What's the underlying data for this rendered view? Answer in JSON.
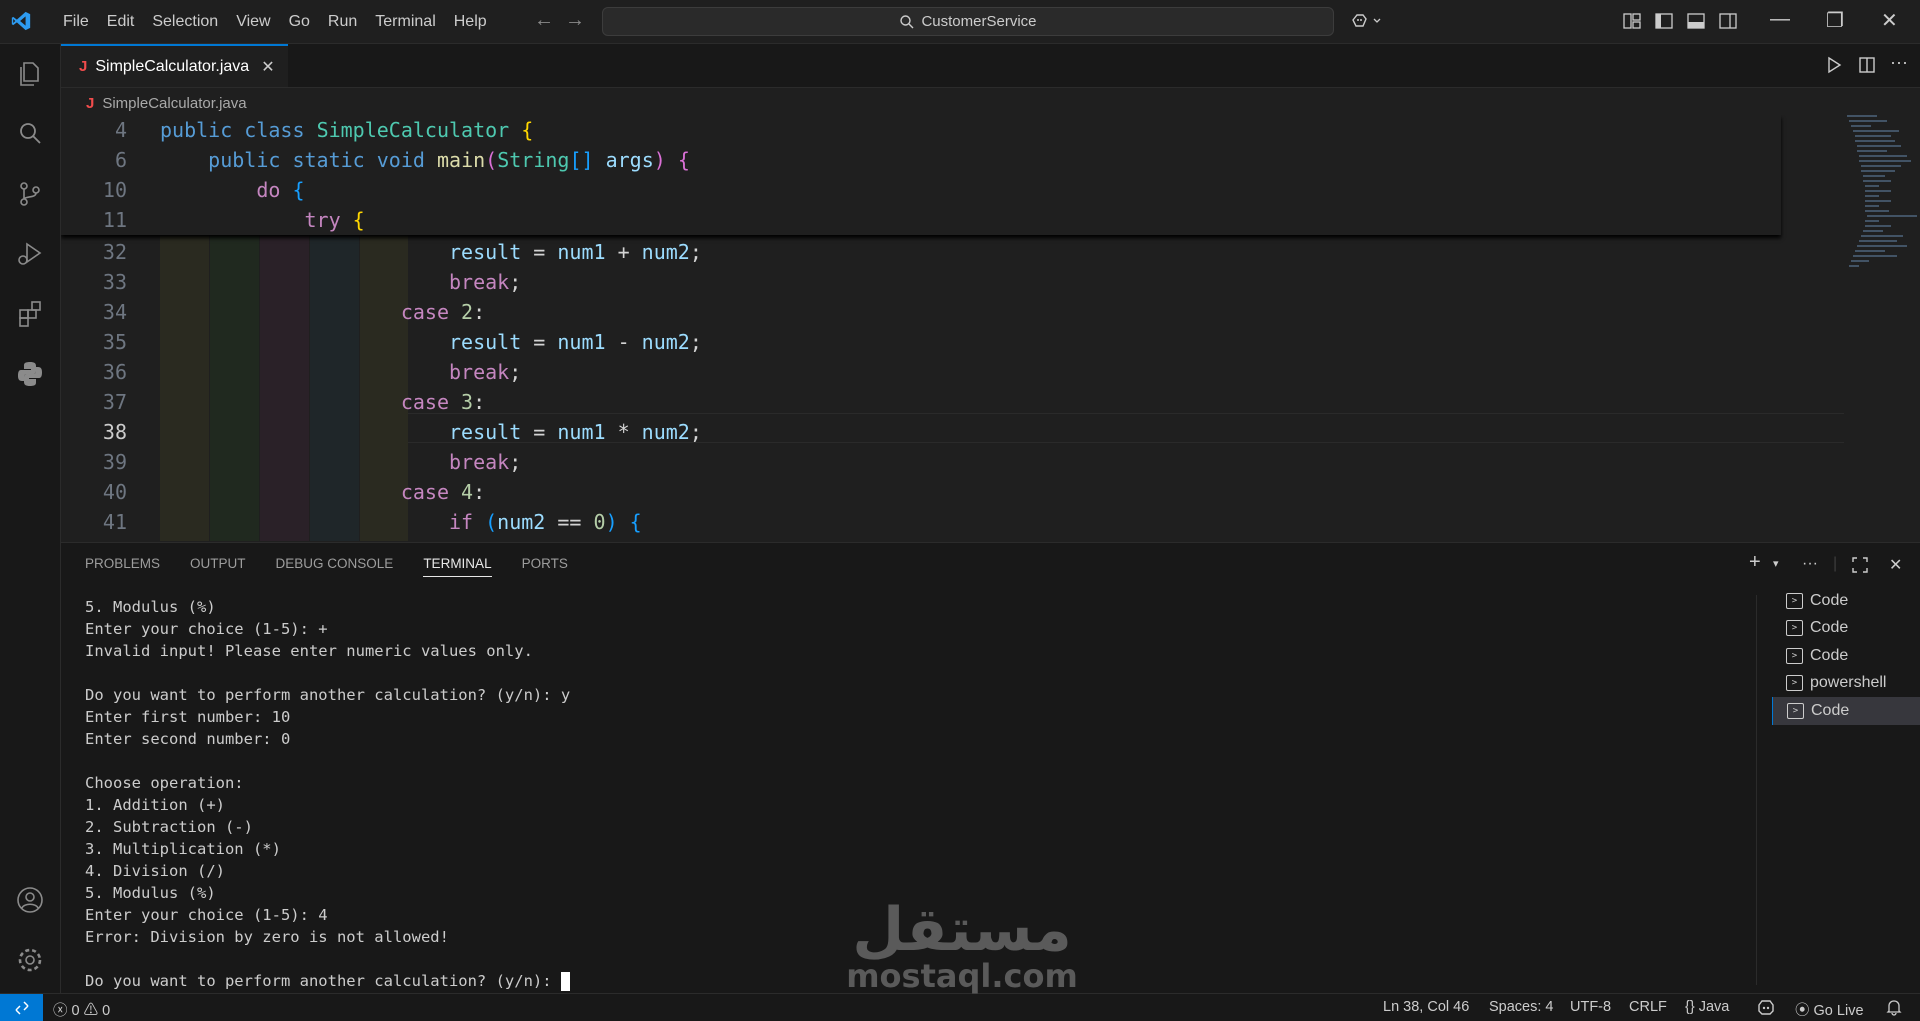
{
  "menu": [
    "File",
    "Edit",
    "Selection",
    "View",
    "Go",
    "Run",
    "Terminal",
    "Help"
  ],
  "search": {
    "label": "CustomerService"
  },
  "tab": {
    "icon_letter": "J",
    "name": "SimpleCalculator.java",
    "close": "✕"
  },
  "breadcrumb": {
    "file": "SimpleCalculator.java"
  },
  "editor": {
    "sticky_lines": [
      {
        "ln": "4",
        "segments": [
          [
            "kw",
            "public"
          ],
          [
            "op",
            " "
          ],
          [
            "kw",
            "class"
          ],
          [
            "op",
            " "
          ],
          [
            "cls",
            "SimpleCalculator"
          ],
          [
            "op",
            " "
          ],
          [
            "br1",
            "{"
          ]
        ]
      },
      {
        "ln": "6",
        "segments": [
          [
            "op",
            "    "
          ],
          [
            "kw",
            "public"
          ],
          [
            "op",
            " "
          ],
          [
            "kw",
            "static"
          ],
          [
            "op",
            " "
          ],
          [
            "kw",
            "void"
          ],
          [
            "op",
            " "
          ],
          [
            "fn",
            "main"
          ],
          [
            "br2",
            "("
          ],
          [
            "cls",
            "String"
          ],
          [
            "br3",
            "[]"
          ],
          [
            "op",
            " "
          ],
          [
            "var",
            "args"
          ],
          [
            "br2",
            ")"
          ],
          [
            "op",
            " "
          ],
          [
            "br2",
            "{"
          ]
        ]
      },
      {
        "ln": "10",
        "segments": [
          [
            "op",
            "        "
          ],
          [
            "kw2",
            "do"
          ],
          [
            "op",
            " "
          ],
          [
            "br3",
            "{"
          ]
        ]
      },
      {
        "ln": "11",
        "segments": [
          [
            "op",
            "            "
          ],
          [
            "kw2",
            "try"
          ],
          [
            "op",
            " "
          ],
          [
            "br1",
            "{"
          ]
        ]
      }
    ],
    "lines": [
      {
        "ln": "32",
        "segments": [
          [
            "op",
            "                        "
          ],
          [
            "var",
            "result"
          ],
          [
            "op",
            " = "
          ],
          [
            "var",
            "num1"
          ],
          [
            "op",
            " + "
          ],
          [
            "var",
            "num2"
          ],
          [
            "op",
            ";"
          ]
        ]
      },
      {
        "ln": "33",
        "segments": [
          [
            "op",
            "                        "
          ],
          [
            "kw2",
            "break"
          ],
          [
            "op",
            ";"
          ]
        ]
      },
      {
        "ln": "34",
        "segments": [
          [
            "op",
            "                    "
          ],
          [
            "kw2",
            "case"
          ],
          [
            "op",
            " "
          ],
          [
            "num",
            "2"
          ],
          [
            "op",
            ":"
          ]
        ]
      },
      {
        "ln": "35",
        "segments": [
          [
            "op",
            "                        "
          ],
          [
            "var",
            "result"
          ],
          [
            "op",
            " = "
          ],
          [
            "var",
            "num1"
          ],
          [
            "op",
            " - "
          ],
          [
            "var",
            "num2"
          ],
          [
            "op",
            ";"
          ]
        ]
      },
      {
        "ln": "36",
        "segments": [
          [
            "op",
            "                        "
          ],
          [
            "kw2",
            "break"
          ],
          [
            "op",
            ";"
          ]
        ]
      },
      {
        "ln": "37",
        "segments": [
          [
            "op",
            "                    "
          ],
          [
            "kw2",
            "case"
          ],
          [
            "op",
            " "
          ],
          [
            "num",
            "3"
          ],
          [
            "op",
            ":"
          ]
        ]
      },
      {
        "ln": "38",
        "segments": [
          [
            "op",
            "                        "
          ],
          [
            "var",
            "result"
          ],
          [
            "op",
            " = "
          ],
          [
            "var",
            "num1"
          ],
          [
            "op",
            " * "
          ],
          [
            "var",
            "num2"
          ],
          [
            "op",
            ";"
          ]
        ]
      },
      {
        "ln": "39",
        "segments": [
          [
            "op",
            "                        "
          ],
          [
            "kw2",
            "break"
          ],
          [
            "op",
            ";"
          ]
        ]
      },
      {
        "ln": "40",
        "segments": [
          [
            "op",
            "                    "
          ],
          [
            "kw2",
            "case"
          ],
          [
            "op",
            " "
          ],
          [
            "num",
            "4"
          ],
          [
            "op",
            ":"
          ]
        ]
      },
      {
        "ln": "41",
        "segments": [
          [
            "op",
            "                        "
          ],
          [
            "kw2",
            "if"
          ],
          [
            "op",
            " "
          ],
          [
            "br3",
            "("
          ],
          [
            "var",
            "num2"
          ],
          [
            "op",
            " == "
          ],
          [
            "num",
            "0"
          ],
          [
            "br3",
            ")"
          ],
          [
            "op",
            " "
          ],
          [
            "br3",
            "{"
          ]
        ]
      }
    ],
    "current_line": "38"
  },
  "panel": {
    "tabs": [
      "PROBLEMS",
      "OUTPUT",
      "DEBUG CONSOLE",
      "TERMINAL",
      "PORTS"
    ],
    "active_tab": "TERMINAL"
  },
  "terminal": {
    "lines": [
      "5. Modulus (%)",
      "Enter your choice (1-5): +",
      "Invalid input! Please enter numeric values only.",
      "",
      "Do you want to perform another calculation? (y/n): y",
      "Enter first number: 10",
      "Enter second number: 0",
      "",
      "Choose operation:",
      "1. Addition (+)",
      "2. Subtraction (-)",
      "3. Multiplication (*)",
      "4. Division (/)",
      "5. Modulus (%)",
      "Enter your choice (1-5): 4",
      "Error: Division by zero is not allowed!",
      ""
    ],
    "prompt": "Do you want to perform another calculation? (y/n): ",
    "sessions": [
      {
        "name": "Code",
        "selected": false
      },
      {
        "name": "Code",
        "selected": false
      },
      {
        "name": "Code",
        "selected": false
      },
      {
        "name": "powershell",
        "selected": false
      },
      {
        "name": "Code",
        "selected": true
      }
    ]
  },
  "status": {
    "errors": "0",
    "warnings": "0",
    "position": "Ln 38, Col 46",
    "spaces": "Spaces: 4",
    "encoding": "UTF-8",
    "eol": "CRLF",
    "language": "Java",
    "golive": "Go Live"
  },
  "watermark": {
    "arabic": "مستقل",
    "latin": "mostaql.com"
  },
  "colors": {
    "accent": "#0078d4",
    "background": "#1f1f1f",
    "panel": "#181818"
  }
}
